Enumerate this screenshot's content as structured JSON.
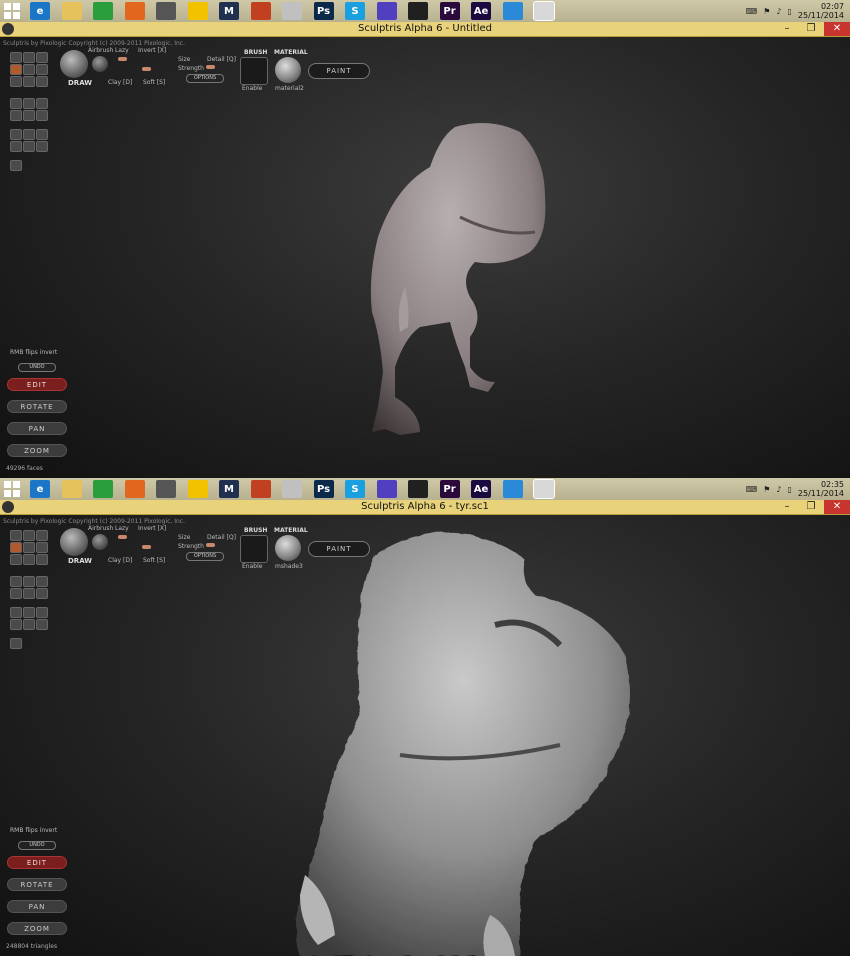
{
  "shots": [
    {
      "clock": {
        "time": "02:07",
        "date": "25/11/2014"
      },
      "window_title": "Sculptris Alpha 6 - Untitled",
      "hint": "",
      "material_name": "material2",
      "status": "49296 faces"
    },
    {
      "clock": {
        "time": "02:35",
        "date": "25/11/2014"
      },
      "window_title": "Sculptris Alpha 6 - tyr.sc1",
      "hint": "",
      "material_name": "mshade3",
      "status": "248804 triangles"
    }
  ],
  "app": {
    "copyright": "Sculptris by Pixologic    Copyright (c) 2009-2011 Pixologic, Inc.",
    "tool_name": "DRAW",
    "airbrush": "Airbrush",
    "lazy": "Lazy",
    "invert": "Invert [X]",
    "size": "Size",
    "detail": "Detail [Q]",
    "strength": "Strength",
    "clay": "Clay [D]",
    "soft": "Soft [S]",
    "options": "OPTIONS",
    "brush_label": "BRUSH",
    "enable": "Enable",
    "material_label": "MATERIAL",
    "paint": "PAINT",
    "rmb": "RMB flips invert",
    "undo": "UNDO",
    "edit": "EDIT",
    "rotate": "ROTATE",
    "pan": "PAN",
    "zoom": "ZOOM"
  },
  "taskbar_icons": [
    {
      "name": "internet-explorer-icon",
      "color": "#1c76c8",
      "glyph": "e"
    },
    {
      "name": "file-explorer-icon",
      "color": "#e6c35a",
      "glyph": ""
    },
    {
      "name": "store-icon",
      "color": "#2a9d3c",
      "glyph": ""
    },
    {
      "name": "firefox-icon",
      "color": "#e2661d",
      "glyph": ""
    },
    {
      "name": "tool-icon",
      "color": "#555555",
      "glyph": ""
    },
    {
      "name": "folder-app-icon",
      "color": "#f2c200",
      "glyph": ""
    },
    {
      "name": "m-app-icon",
      "color": "#203050",
      "glyph": "M"
    },
    {
      "name": "pencil-icon",
      "color": "#c04020",
      "glyph": ""
    },
    {
      "name": "paint-app-icon",
      "color": "#c0c0c0",
      "glyph": ""
    },
    {
      "name": "photoshop-icon",
      "color": "#0b2a4a",
      "glyph": "Ps"
    },
    {
      "name": "skype-icon",
      "color": "#1aa0e0",
      "glyph": "S"
    },
    {
      "name": "settings-app-icon",
      "color": "#5040c0",
      "glyph": ""
    },
    {
      "name": "camera-app-icon",
      "color": "#202020",
      "glyph": ""
    },
    {
      "name": "premiere-icon",
      "color": "#2a0a3a",
      "glyph": "Pr"
    },
    {
      "name": "after-effects-icon",
      "color": "#1a0a40",
      "glyph": "Ae"
    },
    {
      "name": "desktop-app-icon",
      "color": "#2a8ad8",
      "glyph": ""
    },
    {
      "name": "sculptris-icon",
      "color": "#d8d8d8",
      "glyph": ""
    }
  ]
}
